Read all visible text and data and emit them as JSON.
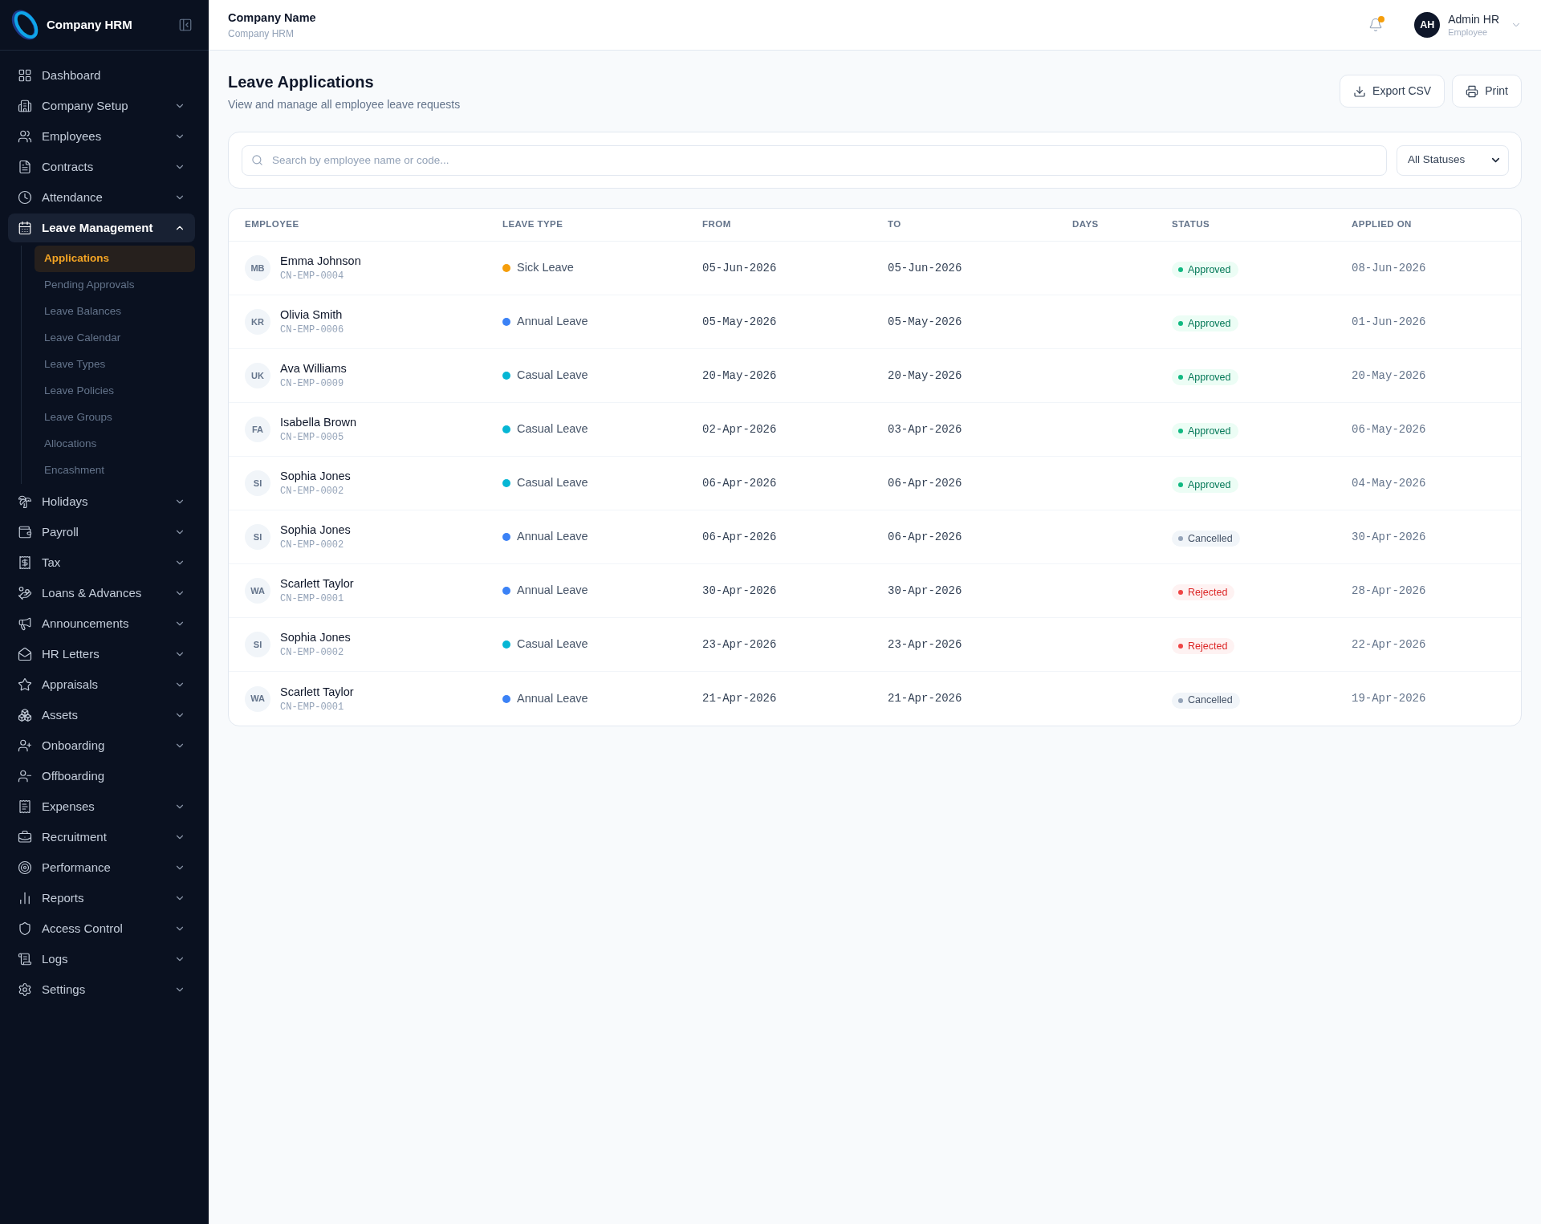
{
  "sidebar": {
    "brand": "Company HRM",
    "items": [
      {
        "label": "Dashboard",
        "kind": "link",
        "selected": false
      },
      {
        "label": "Company Setup",
        "kind": "group",
        "selected": false,
        "expanded": false
      },
      {
        "label": "Employees",
        "kind": "group",
        "selected": false,
        "expanded": false
      },
      {
        "label": "Contracts",
        "kind": "group",
        "selected": false,
        "expanded": false
      },
      {
        "label": "Attendance",
        "kind": "group",
        "selected": false,
        "expanded": false
      },
      {
        "label": "Leave Management",
        "kind": "group",
        "selected": true,
        "expanded": true,
        "children": [
          {
            "label": "Applications",
            "selected": true
          },
          {
            "label": "Pending Approvals",
            "selected": false
          },
          {
            "label": "Leave Balances",
            "selected": false
          },
          {
            "label": "Leave Calendar",
            "selected": false
          },
          {
            "label": "Leave Types",
            "selected": false
          },
          {
            "label": "Leave Policies",
            "selected": false
          },
          {
            "label": "Leave Groups",
            "selected": false
          },
          {
            "label": "Allocations",
            "selected": false
          },
          {
            "label": "Encashment",
            "selected": false
          }
        ]
      },
      {
        "label": "Holidays",
        "kind": "group",
        "selected": false,
        "expanded": false
      },
      {
        "label": "Payroll",
        "kind": "group",
        "selected": false,
        "expanded": false
      },
      {
        "label": "Tax",
        "kind": "group",
        "selected": false,
        "expanded": false
      },
      {
        "label": "Loans & Advances",
        "kind": "group",
        "selected": false,
        "expanded": false
      },
      {
        "label": "Announcements",
        "kind": "group",
        "selected": false,
        "expanded": false
      },
      {
        "label": "HR Letters",
        "kind": "group",
        "selected": false,
        "expanded": false
      },
      {
        "label": "Appraisals",
        "kind": "group",
        "selected": false,
        "expanded": false
      },
      {
        "label": "Assets",
        "kind": "group",
        "selected": false,
        "expanded": false
      },
      {
        "label": "Onboarding",
        "kind": "group",
        "selected": false,
        "expanded": false
      },
      {
        "label": "Offboarding",
        "kind": "link",
        "selected": false
      },
      {
        "label": "Expenses",
        "kind": "group",
        "selected": false,
        "expanded": false
      },
      {
        "label": "Recruitment",
        "kind": "group",
        "selected": false,
        "expanded": false
      },
      {
        "label": "Performance",
        "kind": "group",
        "selected": false,
        "expanded": false
      },
      {
        "label": "Reports",
        "kind": "group",
        "selected": false,
        "expanded": false
      },
      {
        "label": "Access Control",
        "kind": "group",
        "selected": false,
        "expanded": false
      },
      {
        "label": "Logs",
        "kind": "group",
        "selected": false,
        "expanded": false
      },
      {
        "label": "Settings",
        "kind": "group",
        "selected": false,
        "expanded": false
      }
    ]
  },
  "header": {
    "company_name": "Company Name",
    "company_subtitle": "Company HRM",
    "notifications": {
      "unread": true
    },
    "user": {
      "initials": "AH",
      "name": "Admin HR",
      "role": "Employee"
    }
  },
  "page": {
    "title": "Leave Applications",
    "subtitle": "View and manage all employee leave requests",
    "actions": [
      {
        "label": "Export CSV"
      },
      {
        "label": "Print"
      }
    ]
  },
  "filters": {
    "search": {
      "placeholder": "Search by employee name or code..."
    },
    "status_select": {
      "value": "All Statuses"
    }
  },
  "table": {
    "columns": [
      "EMPLOYEE",
      "LEAVE TYPE",
      "FROM",
      "TO",
      "DAYS",
      "STATUS",
      "APPLIED ON"
    ],
    "rows": [
      {
        "initials": "MB",
        "name": "Emma Johnson",
        "code": "CN-EMP-0004",
        "leave_type": {
          "label": "Sick Leave",
          "color": "#f59e0b"
        },
        "from": "05-Jun-2026",
        "to": "05-Jun-2026",
        "status": {
          "label": "Approved",
          "kind": "approved"
        },
        "applied_on": "08-Jun-2026"
      },
      {
        "initials": "KR",
        "name": "Olivia Smith",
        "code": "CN-EMP-0006",
        "leave_type": {
          "label": "Annual Leave",
          "color": "#3b82f6"
        },
        "from": "05-May-2026",
        "to": "05-May-2026",
        "status": {
          "label": "Approved",
          "kind": "approved"
        },
        "applied_on": "01-Jun-2026"
      },
      {
        "initials": "UK",
        "name": "Ava Williams",
        "code": "CN-EMP-0009",
        "leave_type": {
          "label": "Casual Leave",
          "color": "#06b6d4"
        },
        "from": "20-May-2026",
        "to": "20-May-2026",
        "status": {
          "label": "Approved",
          "kind": "approved"
        },
        "applied_on": "20-May-2026"
      },
      {
        "initials": "FA",
        "name": "Isabella Brown",
        "code": "CN-EMP-0005",
        "leave_type": {
          "label": "Casual Leave",
          "color": "#06b6d4"
        },
        "from": "02-Apr-2026",
        "to": "03-Apr-2026",
        "status": {
          "label": "Approved",
          "kind": "approved"
        },
        "applied_on": "06-May-2026"
      },
      {
        "initials": "SI",
        "name": "Sophia Jones",
        "code": "CN-EMP-0002",
        "leave_type": {
          "label": "Casual Leave",
          "color": "#06b6d4"
        },
        "from": "06-Apr-2026",
        "to": "06-Apr-2026",
        "status": {
          "label": "Approved",
          "kind": "approved"
        },
        "applied_on": "04-May-2026"
      },
      {
        "initials": "SI",
        "name": "Sophia Jones",
        "code": "CN-EMP-0002",
        "leave_type": {
          "label": "Annual Leave",
          "color": "#3b82f6"
        },
        "from": "06-Apr-2026",
        "to": "06-Apr-2026",
        "status": {
          "label": "Cancelled",
          "kind": "cancelled"
        },
        "applied_on": "30-Apr-2026"
      },
      {
        "initials": "WA",
        "name": "Scarlett Taylor",
        "code": "CN-EMP-0001",
        "leave_type": {
          "label": "Annual Leave",
          "color": "#3b82f6"
        },
        "from": "30-Apr-2026",
        "to": "30-Apr-2026",
        "status": {
          "label": "Rejected",
          "kind": "rejected"
        },
        "applied_on": "28-Apr-2026"
      },
      {
        "initials": "SI",
        "name": "Sophia Jones",
        "code": "CN-EMP-0002",
        "leave_type": {
          "label": "Casual Leave",
          "color": "#06b6d4"
        },
        "from": "23-Apr-2026",
        "to": "23-Apr-2026",
        "status": {
          "label": "Rejected",
          "kind": "rejected"
        },
        "applied_on": "22-Apr-2026"
      },
      {
        "initials": "WA",
        "name": "Scarlett Taylor",
        "code": "CN-EMP-0001",
        "leave_type": {
          "label": "Annual Leave",
          "color": "#3b82f6"
        },
        "from": "21-Apr-2026",
        "to": "21-Apr-2026",
        "status": {
          "label": "Cancelled",
          "kind": "cancelled"
        },
        "applied_on": "19-Apr-2026"
      }
    ]
  }
}
